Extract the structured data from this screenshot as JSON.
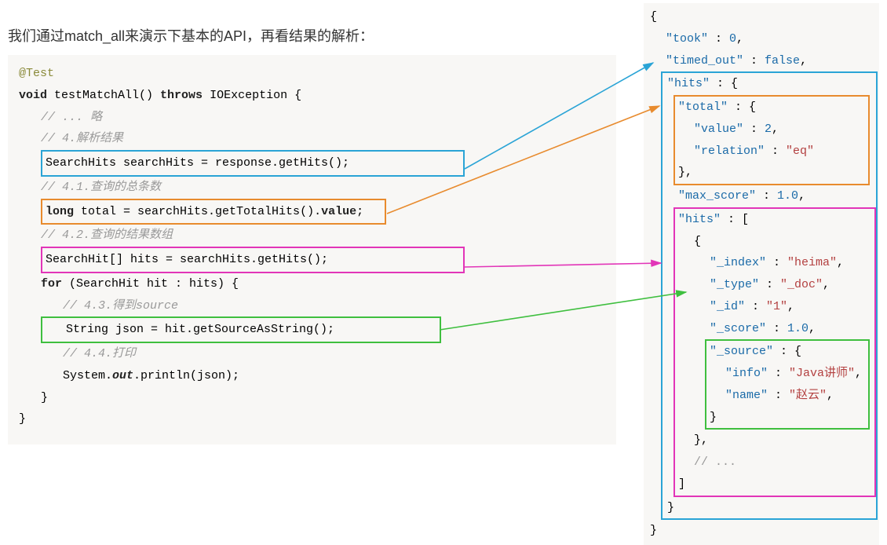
{
  "heading": "我们通过match_all来演示下基本的API，再看结果的解析：",
  "java": {
    "anno": "@Test",
    "sig_void": "void",
    "sig_name": " testMatchAll() ",
    "sig_throws": "throws",
    "sig_exc": " IOException {",
    "c_skip": "// ... 略",
    "c_4": "// 4.解析结果",
    "line_blue_a": "SearchHits searchHits = response.getHits();",
    "c_41": "// 4.1.查询的总条数",
    "line_orange_long": "long",
    "line_orange_mid": " total = searchHits.getTotalHits().",
    "line_orange_value": "value",
    "line_orange_semi": ";",
    "c_42": "// 4.2.查询的结果数组",
    "line_pink_a": "SearchHit[] hits = searchHits.getHits();",
    "for_kw": "for",
    "for_rest": " (SearchHit hit : hits) {",
    "c_43": "// 4.3.得到source",
    "line_green_a": "String json = hit.getSourceAsString();",
    "c_44": "// 4.4.打印",
    "print_a": "System.",
    "print_out": "out",
    "print_b": ".println(json);",
    "brace_close1": "}",
    "brace_close2": "}"
  },
  "json": {
    "open": "{",
    "took_k": "\"took\"",
    "took_v": "0",
    "timed_k": "\"timed_out\"",
    "timed_v": "false",
    "hits_k": "\"hits\"",
    "total_k": "\"total\"",
    "value_k": "\"value\"",
    "value_v": "2",
    "relation_k": "\"relation\"",
    "relation_v": "\"eq\"",
    "maxscore_k": "\"max_score\"",
    "maxscore_v": "1.0",
    "hits2_k": "\"hits\"",
    "index_k": "\"_index\"",
    "index_v": "\"heima\"",
    "type_k": "\"_type\"",
    "type_v": "\"_doc\"",
    "id_k": "\"_id\"",
    "id_v": "\"1\"",
    "score_k": "\"_score\"",
    "score_v": "1.0",
    "source_k": "\"_source\"",
    "info_k": "\"info\"",
    "info_v": "\"Java讲师\"",
    "name_k": "\"name\"",
    "name_v": "\"赵云\"",
    "ellipsis": "// ...",
    "close": "}"
  }
}
